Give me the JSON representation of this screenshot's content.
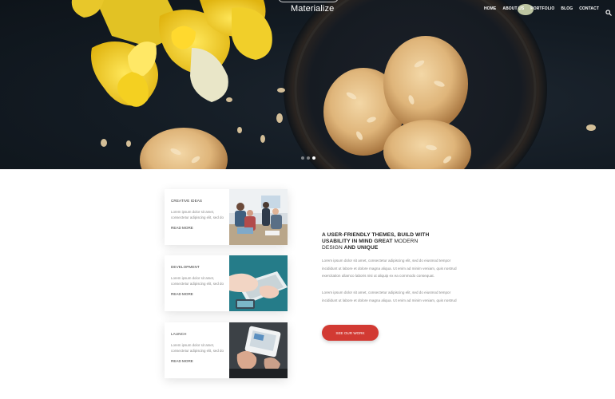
{
  "brand": {
    "name": "Materialize"
  },
  "nav": {
    "items": [
      "HOME",
      "ABOUT US",
      "PORTFOLIO",
      "BLOG",
      "CONTACT"
    ],
    "search_icon": "search-icon"
  },
  "slider": {
    "slide_count": 3,
    "active_index": 2
  },
  "cards": [
    {
      "title": "CREATIVE IDEAS",
      "text": "Lorem ipsum dolor sit amet, consectetur adipiscing elit, sed do",
      "link": "READ MORE",
      "image": "team-meeting-photo"
    },
    {
      "title": "DEVELOPMENT",
      "text": "Lorem ipsum dolor sit amet, consectetur adipiscing elit, sed do",
      "link": "READ MORE",
      "image": "laptop-typing-photo"
    },
    {
      "title": "LAUNCH",
      "text": "Lorem ipsum dolor sit amet, consectetur adipiscing elit, sed do",
      "link": "READ MORE",
      "image": "tablet-photo"
    }
  ],
  "about": {
    "headline_bold_1": "A USER-FRIENDLY THEMES, BUILD WITH",
    "headline_bold_2": "USABILITY IN MIND GREAT",
    "headline_thin_1": "MODERN",
    "headline_thin_2": "DESIGN",
    "headline_bold_3": "AND UNIQUE",
    "paragraph_1": "Lorem ipsum dolor sit amet, consectetur adipiscing elit, sed do eiusmod tempor incididunt ut labore et dolore magna aliqua. Ut enim ad minim veniam, quis nostrud exercitation ullamco laboris nisi ut aliquip ex ea commodo consequat.",
    "paragraph_2": "Lorem ipsum dolor sit amet, consectetur adipiscing elit, sed do eiusmod tempor incididunt ut labore et dolore magna aliqua. Ut enim ad minim veniam, quis nostrud",
    "button_label": "SEE OUR WORK",
    "button_color": "#d23a33"
  }
}
